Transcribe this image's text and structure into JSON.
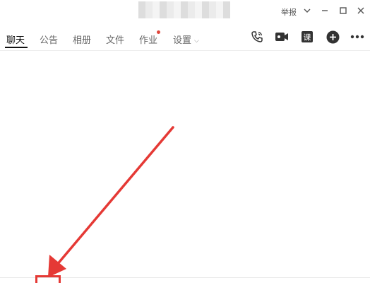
{
  "window": {
    "report_label": "举报",
    "minimize_icon": "chevron-down-icon",
    "restore_icon": "minus-icon",
    "maximize_icon": "square-icon",
    "close_icon": "close-icon"
  },
  "tabs": [
    {
      "label": "聊天",
      "active": true
    },
    {
      "label": "公告",
      "active": false
    },
    {
      "label": "相册",
      "active": false
    },
    {
      "label": "文件",
      "active": false
    },
    {
      "label": "作业",
      "active": false,
      "badge": "red-dot"
    },
    {
      "label": "设置",
      "active": false,
      "dropdown": true
    }
  ],
  "toolbar": {
    "icons": [
      "phone-call-icon",
      "video-call-icon",
      "course-icon",
      "add-circle-icon",
      "more-icon"
    ],
    "course_glyph": "课"
  },
  "colors": {
    "accent_red": "#e53935",
    "active_tab_text": "#111111",
    "inactive_tab_text": "#666666"
  }
}
